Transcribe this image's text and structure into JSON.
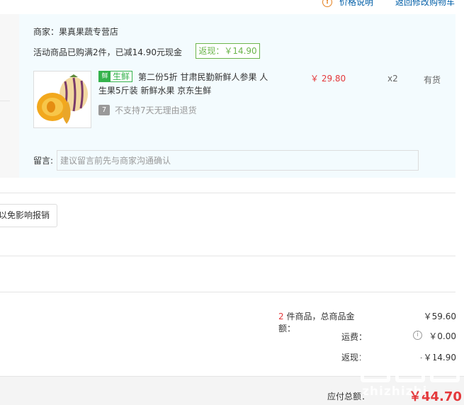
{
  "top": {
    "price_note": "价格说明",
    "back_to_cart": "返回修改购物车"
  },
  "order": {
    "shop_label": "商家：果真果蔬专营店",
    "promo": "活动商品已购满2件，已减14.90元现金",
    "cashback": "返现：￥14.90",
    "fresh_icon": "鲜",
    "fresh_tag": "生鲜",
    "title": "第二份5折 甘肃民勤新鲜人参果 人生果5斤装 新鲜水果 京东生鲜",
    "no_return": "不支持7天无理由退货",
    "no_return_icon": "7",
    "price": "￥ 29.80",
    "qty": "x2",
    "stock": "有货",
    "memo_label": "留言:",
    "memo_placeholder": "建议留言前先与商家沟通确认"
  },
  "invoice": {
    "button": "以免影响报销"
  },
  "summary": {
    "count": "2",
    "count_suffix": " 件商品，总商品金额：",
    "goods_total": "￥59.60",
    "shipping_label": "运费：",
    "shipping_value": "￥0.00",
    "cashback_label": "返现：",
    "cashback_value": "-￥14.90"
  },
  "total": {
    "label": "应付总额：",
    "value": "￥44.70"
  },
  "watermark": {
    "text": "zhizhizhi"
  },
  "colors": {
    "accent_red": "#e4393c",
    "fresh_green": "#34b24c",
    "cashback_green": "#6cb54c",
    "link_blue": "#005ea7",
    "panel_bg": "#f3fbfe"
  },
  "icons": {
    "warn": "warning-circle-icon",
    "info": "info-circle-icon",
    "fresh": "fresh-leaf-icon",
    "no_return": "no-7day-return-icon"
  }
}
